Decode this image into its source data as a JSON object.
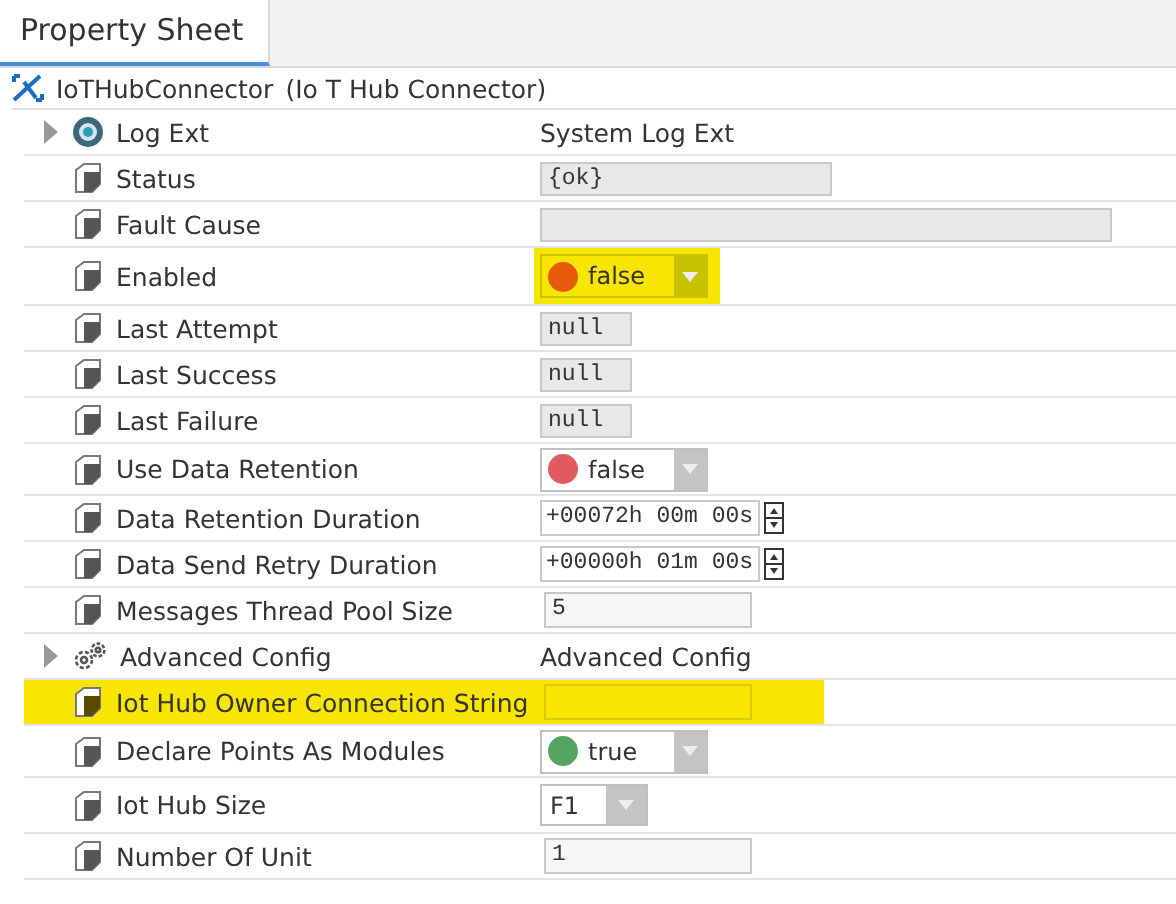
{
  "tab": {
    "label": "Property Sheet",
    "selected": true
  },
  "component": {
    "name": "IoTHubConnector",
    "type": "(Io T Hub Connector)"
  },
  "rows": [
    {
      "name": "Log Ext",
      "kind": "extension",
      "value": "System Log Ext",
      "highlighted": false,
      "name_highlighted": false
    },
    {
      "name": "Status",
      "kind": "status",
      "value": "{ok}",
      "highlighted": false,
      "name_highlighted": false
    },
    {
      "name": "Fault Cause",
      "kind": "fault",
      "value": "",
      "highlighted": false,
      "name_highlighted": false
    },
    {
      "name": "Enabled",
      "kind": "bool",
      "value": "false",
      "color": "#e65a0a",
      "highlighted": true,
      "name_highlighted": false
    },
    {
      "name": "Last Attempt",
      "kind": "timestamp",
      "value": "null",
      "highlighted": false,
      "name_highlighted": false
    },
    {
      "name": "Last Success",
      "kind": "timestamp",
      "value": "null",
      "highlighted": false,
      "name_highlighted": false
    },
    {
      "name": "Last Failure",
      "kind": "timestamp",
      "value": "null",
      "highlighted": false,
      "name_highlighted": false
    },
    {
      "name": "Use Data Retention",
      "kind": "bool",
      "value": "false",
      "color": "#e05a60",
      "highlighted": false,
      "name_highlighted": false
    },
    {
      "name": "Data Retention Duration",
      "kind": "duration",
      "value": "+00072h 00m 00s",
      "highlighted": false,
      "name_highlighted": false
    },
    {
      "name": "Data Send Retry Duration",
      "kind": "duration",
      "value": "+00000h 01m 00s",
      "highlighted": false,
      "name_highlighted": false
    },
    {
      "name": "Messages Thread Pool Size",
      "kind": "text",
      "value": "5",
      "highlighted": false,
      "name_highlighted": false
    },
    {
      "name": "Advanced Config",
      "kind": "config",
      "value": "Advanced Config",
      "highlighted": false,
      "name_highlighted": false
    },
    {
      "name": "Iot Hub Owner Connection String",
      "kind": "text",
      "value": "",
      "highlighted": true,
      "name_highlighted": true
    },
    {
      "name": "Declare Points As Modules",
      "kind": "bool",
      "value": "true",
      "color": "#55a460",
      "highlighted": false,
      "name_highlighted": false
    },
    {
      "name": "Iot Hub Size",
      "kind": "enum",
      "value": "F1",
      "highlighted": false,
      "name_highlighted": false
    },
    {
      "name": "Number Of Unit",
      "kind": "text",
      "value": "1",
      "highlighted": false,
      "name_highlighted": false
    }
  ]
}
